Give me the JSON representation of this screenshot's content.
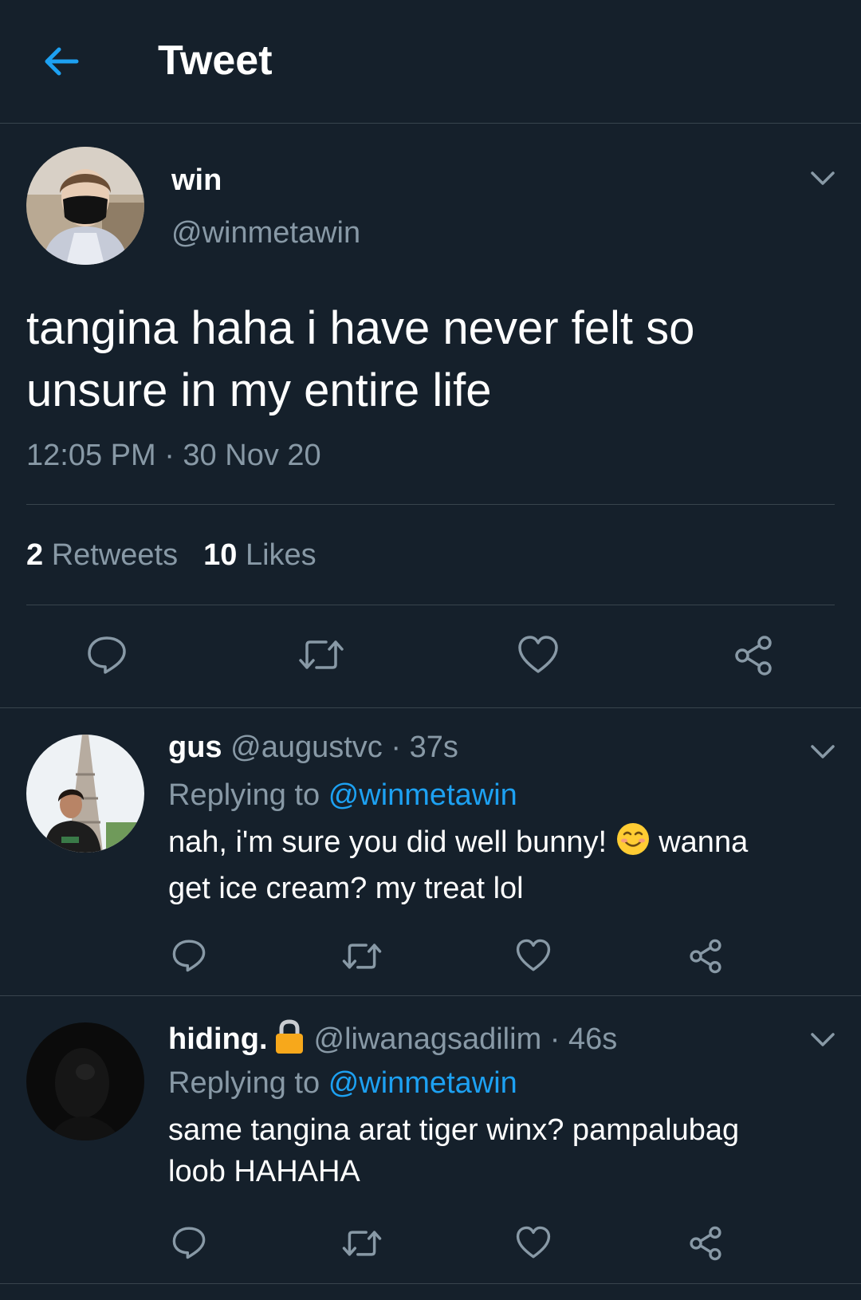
{
  "header": {
    "title": "Tweet",
    "back_icon": "arrow-left-icon"
  },
  "colors": {
    "background": "#15202b",
    "accent": "#1da1f2",
    "muted": "#8899a6",
    "divider": "#38444d"
  },
  "main_tweet": {
    "display_name": "win",
    "handle": "@winmetawin",
    "text_line1": "tangina haha i have never felt so",
    "text_line2": "unsure in my entire life",
    "timestamp": "12:05 PM · 30 Nov 20",
    "retweet_count": "2",
    "retweet_label": "Retweets",
    "like_count": "10",
    "like_label": "Likes"
  },
  "replies": [
    {
      "display_name": "gus",
      "handle": "@augustvc",
      "time": "· 37s",
      "replying_to_label": "Replying to",
      "replying_to_handle": "@winmetawin",
      "text_part1": "nah, i'm sure you did well bunny!",
      "emoji": "smiling-face-icon",
      "text_part2": "wanna",
      "text_line2": "get ice cream? my treat lol"
    },
    {
      "display_name": "hiding.",
      "lock_icon": "lock-icon",
      "handle": "@liwanagsadilim",
      "time": "· 46s",
      "replying_to_label": "Replying to",
      "replying_to_handle": "@winmetawin",
      "text_line1": "same tangina arat tiger winx? pampalubag",
      "text_line2": "loob HAHAHA"
    }
  ]
}
